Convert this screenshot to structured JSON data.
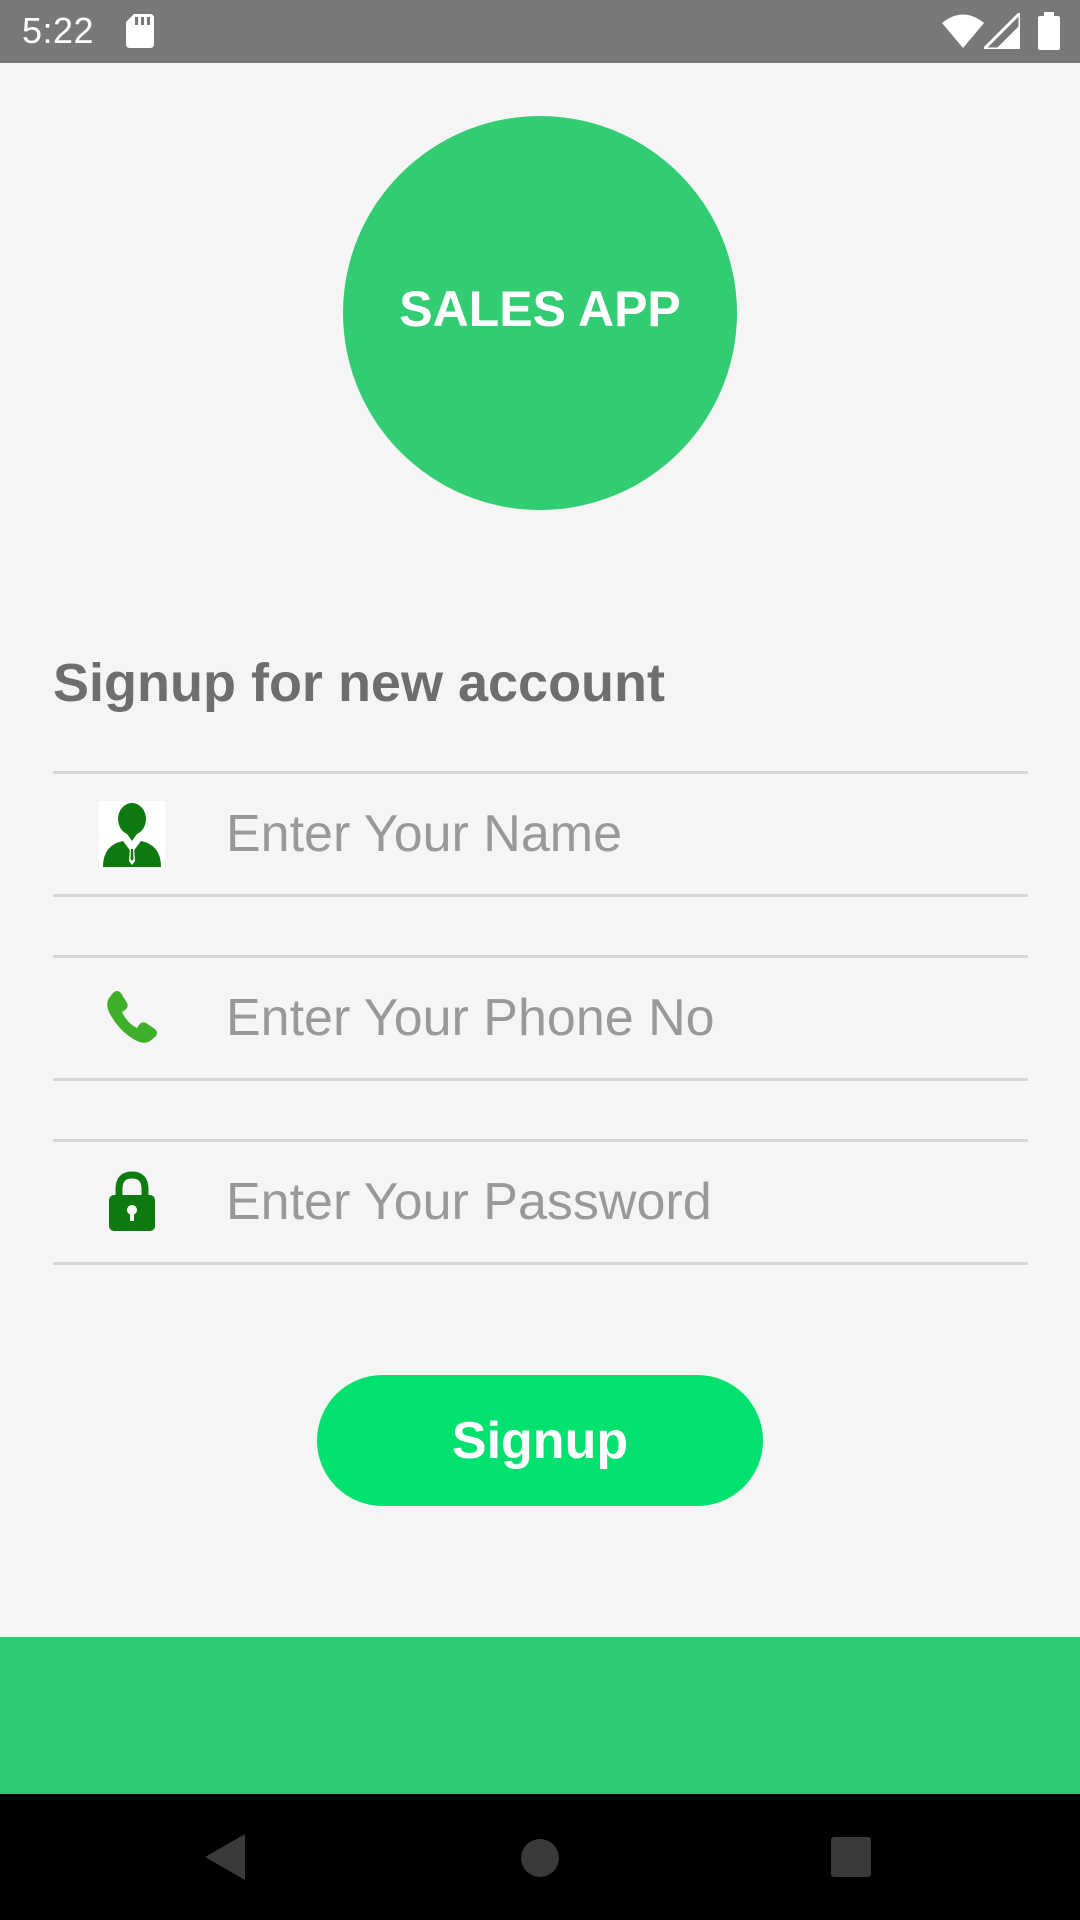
{
  "status_bar": {
    "time": "5:22",
    "icons": [
      "sd-card-icon",
      "wifi-icon",
      "cell-signal-icon",
      "battery-icon"
    ]
  },
  "logo": {
    "text": "SALES APP",
    "color": "#32cd73"
  },
  "form": {
    "heading": "Signup for new account",
    "fields": [
      {
        "icon": "user-icon",
        "value": "",
        "placeholder": "Enter Your Name"
      },
      {
        "icon": "phone-icon",
        "value": "",
        "placeholder": "Enter Your Phone No"
      },
      {
        "icon": "lock-icon",
        "value": "",
        "placeholder": "Enter Your Password"
      }
    ],
    "submit_label": "Signup",
    "submit_color": "#00e16f"
  },
  "footer": {
    "band_color": "#2ecc72"
  },
  "nav_bar": {
    "buttons": [
      "back-icon",
      "home-icon",
      "recents-icon"
    ]
  }
}
